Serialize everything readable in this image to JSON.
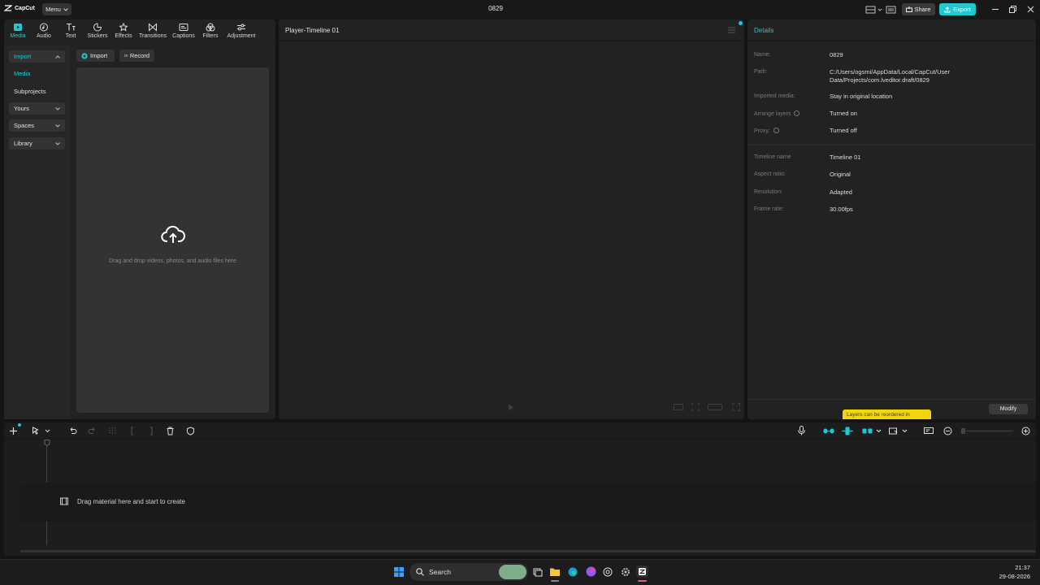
{
  "app": {
    "logo_text": "CapCut",
    "menu_label": "Menu",
    "window_title": "0829",
    "share_label": "Share",
    "export_label": "Export"
  },
  "toolbar": {
    "tabs": [
      {
        "label": "Media",
        "icon": "media-icon"
      },
      {
        "label": "Audio",
        "icon": "audio-icon"
      },
      {
        "label": "Text",
        "icon": "text-icon"
      },
      {
        "label": "Stickers",
        "icon": "stickers-icon"
      },
      {
        "label": "Effects",
        "icon": "effects-icon"
      },
      {
        "label": "Transitions",
        "icon": "transitions-icon"
      },
      {
        "label": "Captions",
        "icon": "captions-icon"
      },
      {
        "label": "Filters",
        "icon": "filters-icon"
      },
      {
        "label": "Adjustment",
        "icon": "adjustment-icon"
      }
    ]
  },
  "sidebar": {
    "items": [
      {
        "label": "Import"
      },
      {
        "label": "Media"
      },
      {
        "label": "Subprojects"
      },
      {
        "label": "Yours"
      },
      {
        "label": "Spaces"
      },
      {
        "label": "Library"
      }
    ]
  },
  "media": {
    "import_label": "Import",
    "record_label": "Record",
    "drop_hint": "Drag and drop videos, photos, and audio files here"
  },
  "player": {
    "title": "Player-Timeline 01"
  },
  "details": {
    "title": "Details",
    "rows": [
      {
        "label": "Name:",
        "value": "0829"
      },
      {
        "label": "Path:",
        "value": "C:/Users/ogsmi/AppData/Local/CapCut/User Data/Projects/com.lveditor.draft/0829"
      },
      {
        "label": "Imported media:",
        "value": "Stay in original location"
      },
      {
        "label": "Arrange layers",
        "value": "Turned on"
      },
      {
        "label": "Proxy:",
        "value": "Turned off"
      },
      {
        "label": "Timeline name",
        "value": "Timeline 01"
      },
      {
        "label": "Aspect ratio:",
        "value": "Original"
      },
      {
        "label": "Resolution:",
        "value": "Adapted"
      },
      {
        "label": "Frame rate:",
        "value": "30.00fps"
      }
    ],
    "modify_label": "Modify",
    "tooltip": "Layers can be reordered in"
  },
  "timeline": {
    "hint": "Drag material here and start to create"
  },
  "taskbar": {
    "search_placeholder": "Search",
    "time": "21:37",
    "date": "29-08-2026"
  },
  "colors": {
    "accent": "#22c8cf",
    "tooltip": "#f2d50a",
    "background": "#141414",
    "panel": "#222222"
  }
}
